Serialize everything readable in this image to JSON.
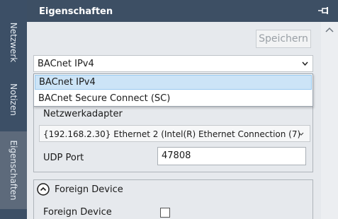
{
  "side_tabs": [
    {
      "label": "Netzwerk"
    },
    {
      "label": "Notizen"
    },
    {
      "label": "Eigenschaften"
    }
  ],
  "panel": {
    "title": "Eigenschaften",
    "pin_icon": "pin-icon"
  },
  "toolbar": {
    "save_label": "Speichern"
  },
  "protocol": {
    "selected": "BACnet IPv4",
    "options": [
      "BACnet IPv4",
      "BACnet Secure Connect (SC)"
    ]
  },
  "network": {
    "adapter_label": "Netzwerkadapter",
    "adapter_value": "{192.168.2.30} Ethernet 2 (Intel(R) Ethernet Connection (7)",
    "udp_label": "UDP Port",
    "udp_value": "47808"
  },
  "foreign_device": {
    "header": "Foreign Device",
    "label": "Foreign Device",
    "checked": false
  },
  "colors": {
    "sidebar": "#3c4f66",
    "header": "#3d4f64",
    "selection": "#cce4f7",
    "panel_bg": "#e6e9ed"
  }
}
